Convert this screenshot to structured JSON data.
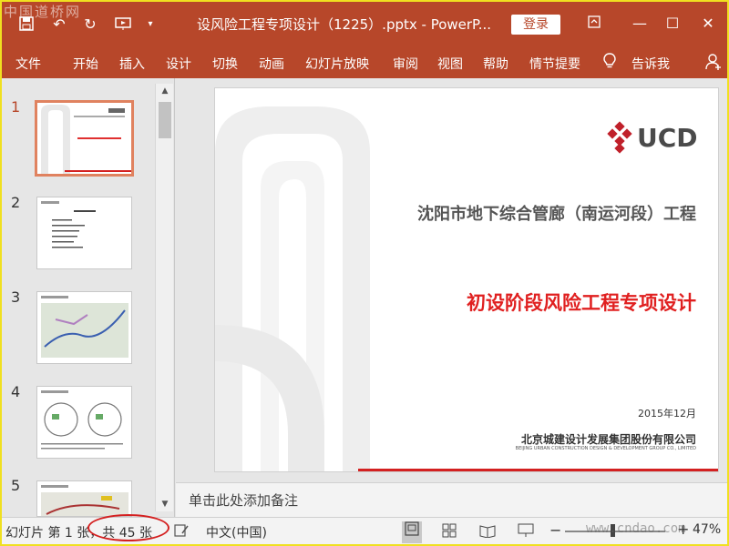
{
  "watermark_top": "中国道桥网",
  "watermark_bottom": "www.cndao.com",
  "title_bar": {
    "document_title": "设风险工程专项设计（1225）.pptx - PowerP...",
    "login_label": "登录"
  },
  "ribbon": {
    "tabs": [
      "文件",
      "开始",
      "插入",
      "设计",
      "切换",
      "动画",
      "幻灯片放映",
      "审阅",
      "视图",
      "帮助",
      "情节提要"
    ],
    "tell_me": "告诉我"
  },
  "thumbnails": {
    "numbers": [
      "1",
      "2",
      "3",
      "4",
      "5"
    ],
    "active_index": 1
  },
  "slide": {
    "logo_text": "UCD",
    "subtitle": "沈阳市地下综合管廊（南运河段）工程",
    "title": "初设阶段风险工程专项设计",
    "date": "2015年12月",
    "company": "北京城建设计发展集团股份有限公司",
    "company_en": "BEIJING URBAN CONSTRUCTION DESIGN & DEVELOPMENT GROUP CO., LIMITED"
  },
  "notes": {
    "placeholder": "单击此处添加备注"
  },
  "status_bar": {
    "slide_indicator": "幻灯片 第 1 张，共 45 张",
    "language": "中文(中国)",
    "zoom": "47%"
  },
  "colors": {
    "accent": "#b7472a",
    "title_red": "#e02020",
    "annotation_red": "#d42020"
  }
}
